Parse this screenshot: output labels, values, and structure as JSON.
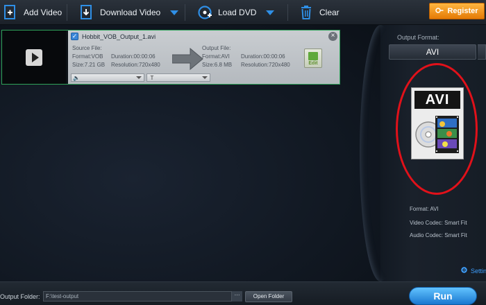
{
  "toolbar": {
    "add_video": "Add Video",
    "download_video": "Download Video",
    "load_dvd": "Load DVD",
    "clear": "Clear",
    "register": "Register"
  },
  "file_item": {
    "filename": "Hobbit_VOB_Output_1.avi",
    "checked": true,
    "source": {
      "heading": "Source File:",
      "format": "Format:VOB",
      "duration": "Duration:00:00:06",
      "size": "Size:7.21 GB",
      "resolution": "Resolution:720x480"
    },
    "output": {
      "heading": "Output File:",
      "format": "Format:AVI",
      "duration": "Duration:00:00:06",
      "size": "Size:6.8 MB",
      "resolution": "Resolution:720x480"
    },
    "edit_label": "Edit",
    "audio_dropdown_symbol": "🔈",
    "subtitle_dropdown_symbol": "T"
  },
  "right_panel": {
    "output_format_label": "Output Format:",
    "selected_format": "AVI",
    "icon_label": "AVI",
    "format_line": "Format: AVI",
    "video_codec": "Video Codec: Smart Fit",
    "audio_codec": "Audio Codec: Smart Fit",
    "settings_label": "Setting"
  },
  "bottom": {
    "output_folder_label": "Output Folder:",
    "folder_value": "F:\\test-output",
    "dots": "···",
    "open_folder": "Open Folder",
    "run": "Run"
  },
  "colors": {
    "accent": "#1f86e0",
    "register": "#f39a1c",
    "highlight": "#e1111a",
    "selection_border": "#2fa35a"
  }
}
